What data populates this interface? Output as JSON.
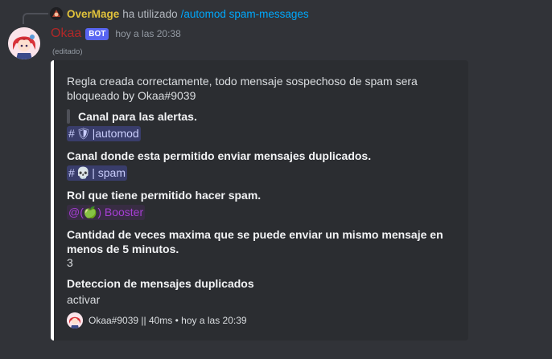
{
  "reply": {
    "author": "OverMage",
    "action": "ha utilizado",
    "command": "/automod spam-messages"
  },
  "message": {
    "username": "Okaa",
    "bot_badge": "BOT",
    "timestamp": "hoy a las 20:38",
    "edited": "(editado)"
  },
  "embed": {
    "description": "Regla creada correctamente, todo mensaje sospechoso de spam sera bloqueado by Okaa#9039",
    "quote_title": "Canal para las alertas.",
    "alerts_channel": {
      "hash": "#",
      "emoji": "🛡",
      "name": "|automod"
    },
    "dup_field_name": "Canal donde esta permitido enviar mensajes duplicados.",
    "spam_channel": {
      "hash": "#",
      "emoji": "💀",
      "name": "| spam"
    },
    "role_field_name": "Rol que tiene permitido hacer spam.",
    "role_mention": {
      "at": "@",
      "prefix": "(",
      "emoji": "🍏",
      "name": ") Booster"
    },
    "count_field_name": "Cantidad de veces maxima que se puede enviar un mismo mensaje en menos de 5 minutos.",
    "count_value": "3",
    "detect_field_name": "Deteccion de mensajes duplicados",
    "detect_value": "activar",
    "footer": "Okaa#9039 || 40ms • hoy a las 20:39",
    "border_color": "#ffffff"
  },
  "colors": {
    "background": "#313338",
    "embed_background": "#2b2d31",
    "username": "#b02828",
    "reply_author": "#e0c23b",
    "command": "#00a8fc",
    "bot_badge": "#5865f2",
    "mention": "#c9cdfb",
    "role_mention": "#a63fd4"
  }
}
